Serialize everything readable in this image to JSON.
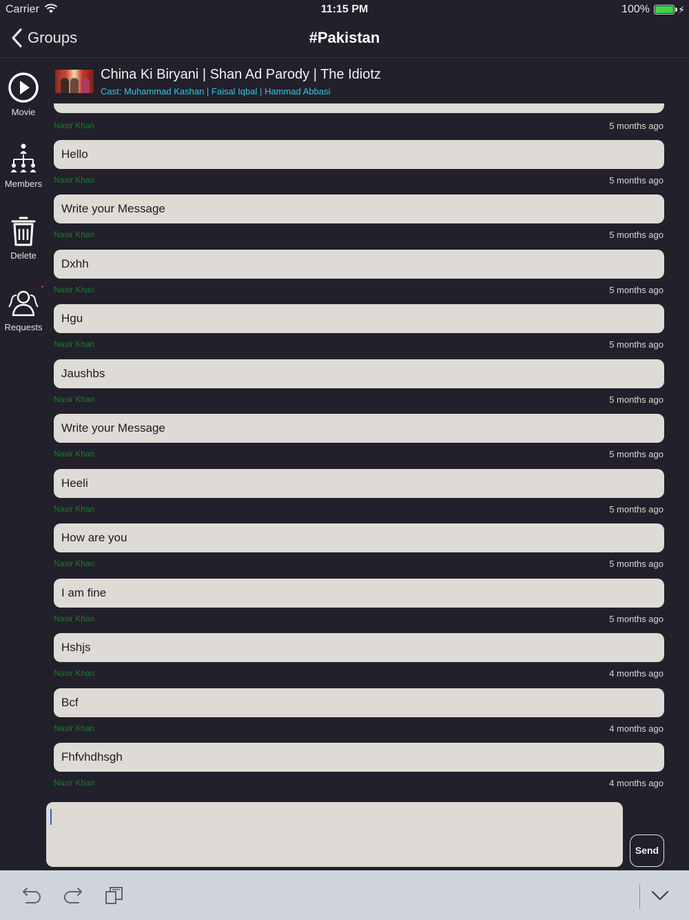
{
  "status_bar": {
    "carrier": "Carrier",
    "time": "11:15 PM",
    "battery": "100%"
  },
  "nav": {
    "back_label": "Groups",
    "title": "#Pakistan"
  },
  "sidebar": {
    "items": [
      {
        "label": "Movie",
        "icon": "play-circle-icon"
      },
      {
        "label": "Members",
        "icon": "members-hierarchy-icon"
      },
      {
        "label": "Delete",
        "icon": "trash-icon"
      },
      {
        "label": "Requests",
        "icon": "requests-people-icon"
      }
    ]
  },
  "movie": {
    "title": "China Ki Biryani | Shan Ad Parody | The Idiotz",
    "cast": "Cast: Muhammad Kashan | Faisal Iqbal | Hammad Abbasi"
  },
  "messages": {
    "top_meta": {
      "sender": "Nasir Khan",
      "time": "5 months ago"
    },
    "items": [
      {
        "text": "Hello",
        "sender": "Nasir Khan",
        "time": "5 months ago"
      },
      {
        "text": "Write your Message",
        "sender": "Nasir Khan",
        "time": "5 months ago"
      },
      {
        "text": "Dxhh",
        "sender": "Nasir Khan",
        "time": "5 months ago"
      },
      {
        "text": "Hgu",
        "sender": "Nasir Khan",
        "time": "5 months ago"
      },
      {
        "text": "Jaushbs",
        "sender": "Nasir Khan",
        "time": "5 months ago"
      },
      {
        "text": "Write your Message",
        "sender": "Nasir Khan",
        "time": "5 months ago"
      },
      {
        "text": "Heeli",
        "sender": "Nasir Khan",
        "time": "5 months ago"
      },
      {
        "text": "How are you",
        "sender": "Nasir Khan",
        "time": "5 months ago"
      },
      {
        "text": "I am fine",
        "sender": "Nasir Khan",
        "time": "5 months ago"
      },
      {
        "text": "Hshjs",
        "sender": "Nasir Khan",
        "time": "4 months ago"
      },
      {
        "text": "Bcf",
        "sender": "Nasir Khan",
        "time": "4 months ago"
      },
      {
        "text": "Fhfvhdhsgh",
        "sender": "Nasir Khan",
        "time": "4 months ago"
      }
    ]
  },
  "composer": {
    "value": "",
    "send_label": "Send"
  },
  "colors": {
    "background": "#22202a",
    "bubble": "#dedad6",
    "sender": "#1e7a30",
    "cast": "#38c5e0",
    "toolbar": "#cfd3dc"
  }
}
